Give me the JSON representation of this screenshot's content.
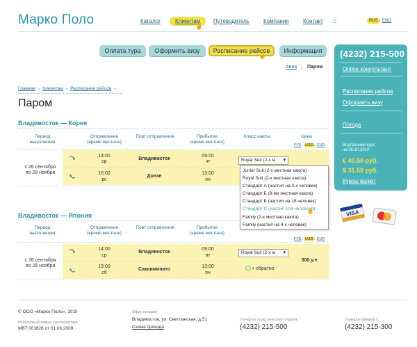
{
  "site": {
    "logo": "Марко Поло"
  },
  "nav": {
    "items": [
      "Каталог",
      "Клиентам",
      "Путеводитель",
      "Компания",
      "Контакт"
    ],
    "lang": [
      "RUS",
      "ENG"
    ]
  },
  "tabs": [
    "Оплата тура",
    "Оформить визу",
    "Расписание рейсов",
    "Информация"
  ],
  "subnav": {
    "avia": "Авиа",
    "ferry": "Паром"
  },
  "breadcrumb": [
    "Главная",
    "Клиентам",
    "Расписание рейсов"
  ],
  "page_title": "Паром",
  "section1": {
    "title": "Владивосток — Корея"
  },
  "section2": {
    "title": "Владивосток — Япония"
  },
  "columns": {
    "period": "Период\nвыполнения",
    "depart": "Отправление\n(время местное)",
    "port": "Порт отправления",
    "arrive": "Прибытие\n(время местное)",
    "class": "Класс каюты",
    "price": "Цена"
  },
  "currencies": [
    "РУБ",
    "USD",
    "EUR"
  ],
  "korea": {
    "period": "с 26 сентября\nпо 28 ноября",
    "rows": [
      {
        "time": "14:00",
        "day": "ср",
        "port": "Владивосток",
        "atime": "09:00",
        "aday": "чт"
      },
      {
        "time": "16:00",
        "day": "вс",
        "port": "Донхе",
        "atime": "13:00",
        "aday": "пн"
      }
    ],
    "cabin": "Royal Suit (2-х м"
  },
  "dropdown": [
    "Junior Suit (2-х местная каюта)",
    "Royal Suit (2-х местная каюта)",
    "Стандарт А (настил на 4-х человек)",
    "Стандарт Б (8-ми местная каюта)",
    "Стандарт Б (настил на 18 человек)",
    "Стандарт С (настил 104 человека)",
    "Family (2-х местная каюта)",
    "Family (настил на 4-х человек)"
  ],
  "japan": {
    "period": "с 26 сентября\nпо 28 ноября",
    "rows": [
      {
        "time": "14:00",
        "day": "ср",
        "port": "Владивосток",
        "atime": "09:00",
        "aday": "пт"
      },
      {
        "time": "19:00",
        "day": "сб",
        "port": "Сакаиминато",
        "atime": "13:00",
        "aday": "пн"
      }
    ],
    "cabin": "Royal Suit (2-х м",
    "price": "300 у.е",
    "return": "+ обратно"
  },
  "panel": {
    "phone": "(4232) 215-500",
    "consultant": "Online консультант",
    "links": [
      "Расписание рейсов",
      "Оформить визу",
      "Погода"
    ],
    "rate_label": "Внутренний курс\nна 06.10.2010",
    "rates": [
      "€  40.50 руб.",
      "$  31.50 руб."
    ],
    "currency_link": "Курсы валют"
  },
  "footer": {
    "copyright": "© ООО «Марко Поло», 2010",
    "reg_label": "Реестровый номер туроператора:",
    "reg_no": "МВТ 001828 от 01.06.2009",
    "office_label": "Офис продаж:",
    "office_addr": "Владивосток, ул. Светланская, д.51",
    "map_link": "Схема проезда",
    "tour_label": "Телефон туристического отдела:",
    "tour_phone": "(4232) 215-500",
    "avia_label": "Телефон авиакасс:",
    "avia_phone": "(4232) 215-300"
  },
  "colors": {
    "accent": "#2c8fa6",
    "highlight": "#f3e04c",
    "panel": "#4ab3b8",
    "row": "#fbf3b3"
  }
}
